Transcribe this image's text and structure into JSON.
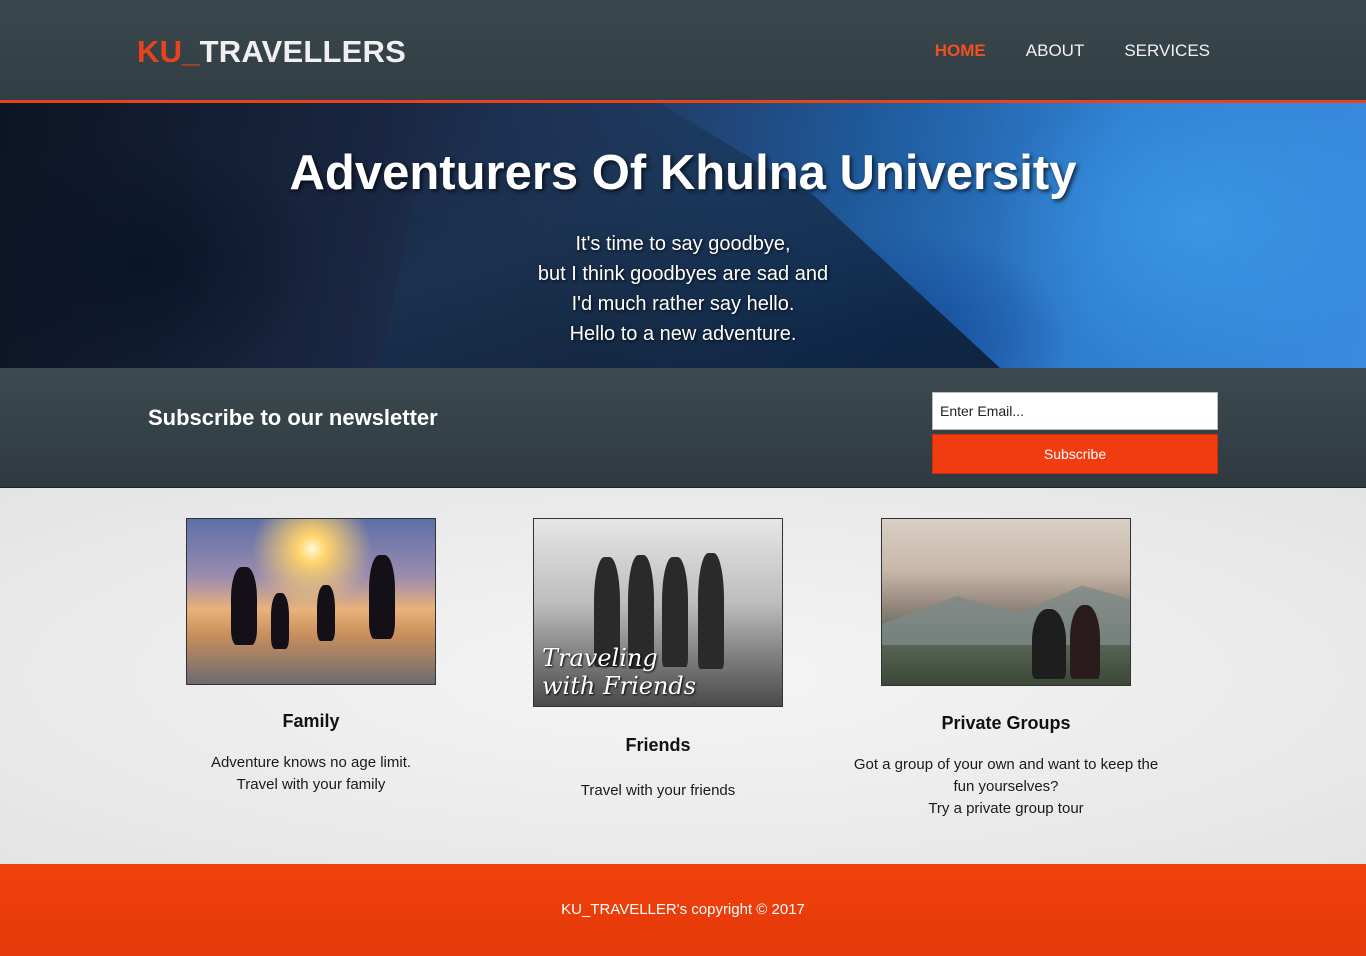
{
  "header": {
    "brand_accent": "KU_",
    "brand_rest": "TRAVELLERS",
    "nav": [
      {
        "label": "HOME",
        "active": true
      },
      {
        "label": "ABOUT",
        "active": false
      },
      {
        "label": "SERVICES",
        "active": false
      }
    ]
  },
  "hero": {
    "title": "Adventurers Of Khulna University",
    "lines": "It's time to say goodbye,\nbut I think goodbyes are sad and\nI'd much rather say hello.\nHello to a new adventure."
  },
  "newsletter": {
    "heading": "Subscribe to our newsletter",
    "email_placeholder": "Enter Email...",
    "button_label": "Subscribe"
  },
  "cards": [
    {
      "title": "Family",
      "text": "Adventure knows no age limit.\nTravel with your family"
    },
    {
      "title": "Friends",
      "text": "Travel with your friends",
      "image_caption": "Traveling\nwith Friends"
    },
    {
      "title": "Private Groups",
      "text": "Got a group of your own and want to keep the\nfun yourselves?\nTry a private group tour"
    }
  ],
  "footer": {
    "copyright": "KU_TRAVELLER's copyright © 2017"
  },
  "colors": {
    "accent": "#e8431f",
    "header_bg": "#36434a",
    "footer_bg": "#ed3e0b"
  }
}
